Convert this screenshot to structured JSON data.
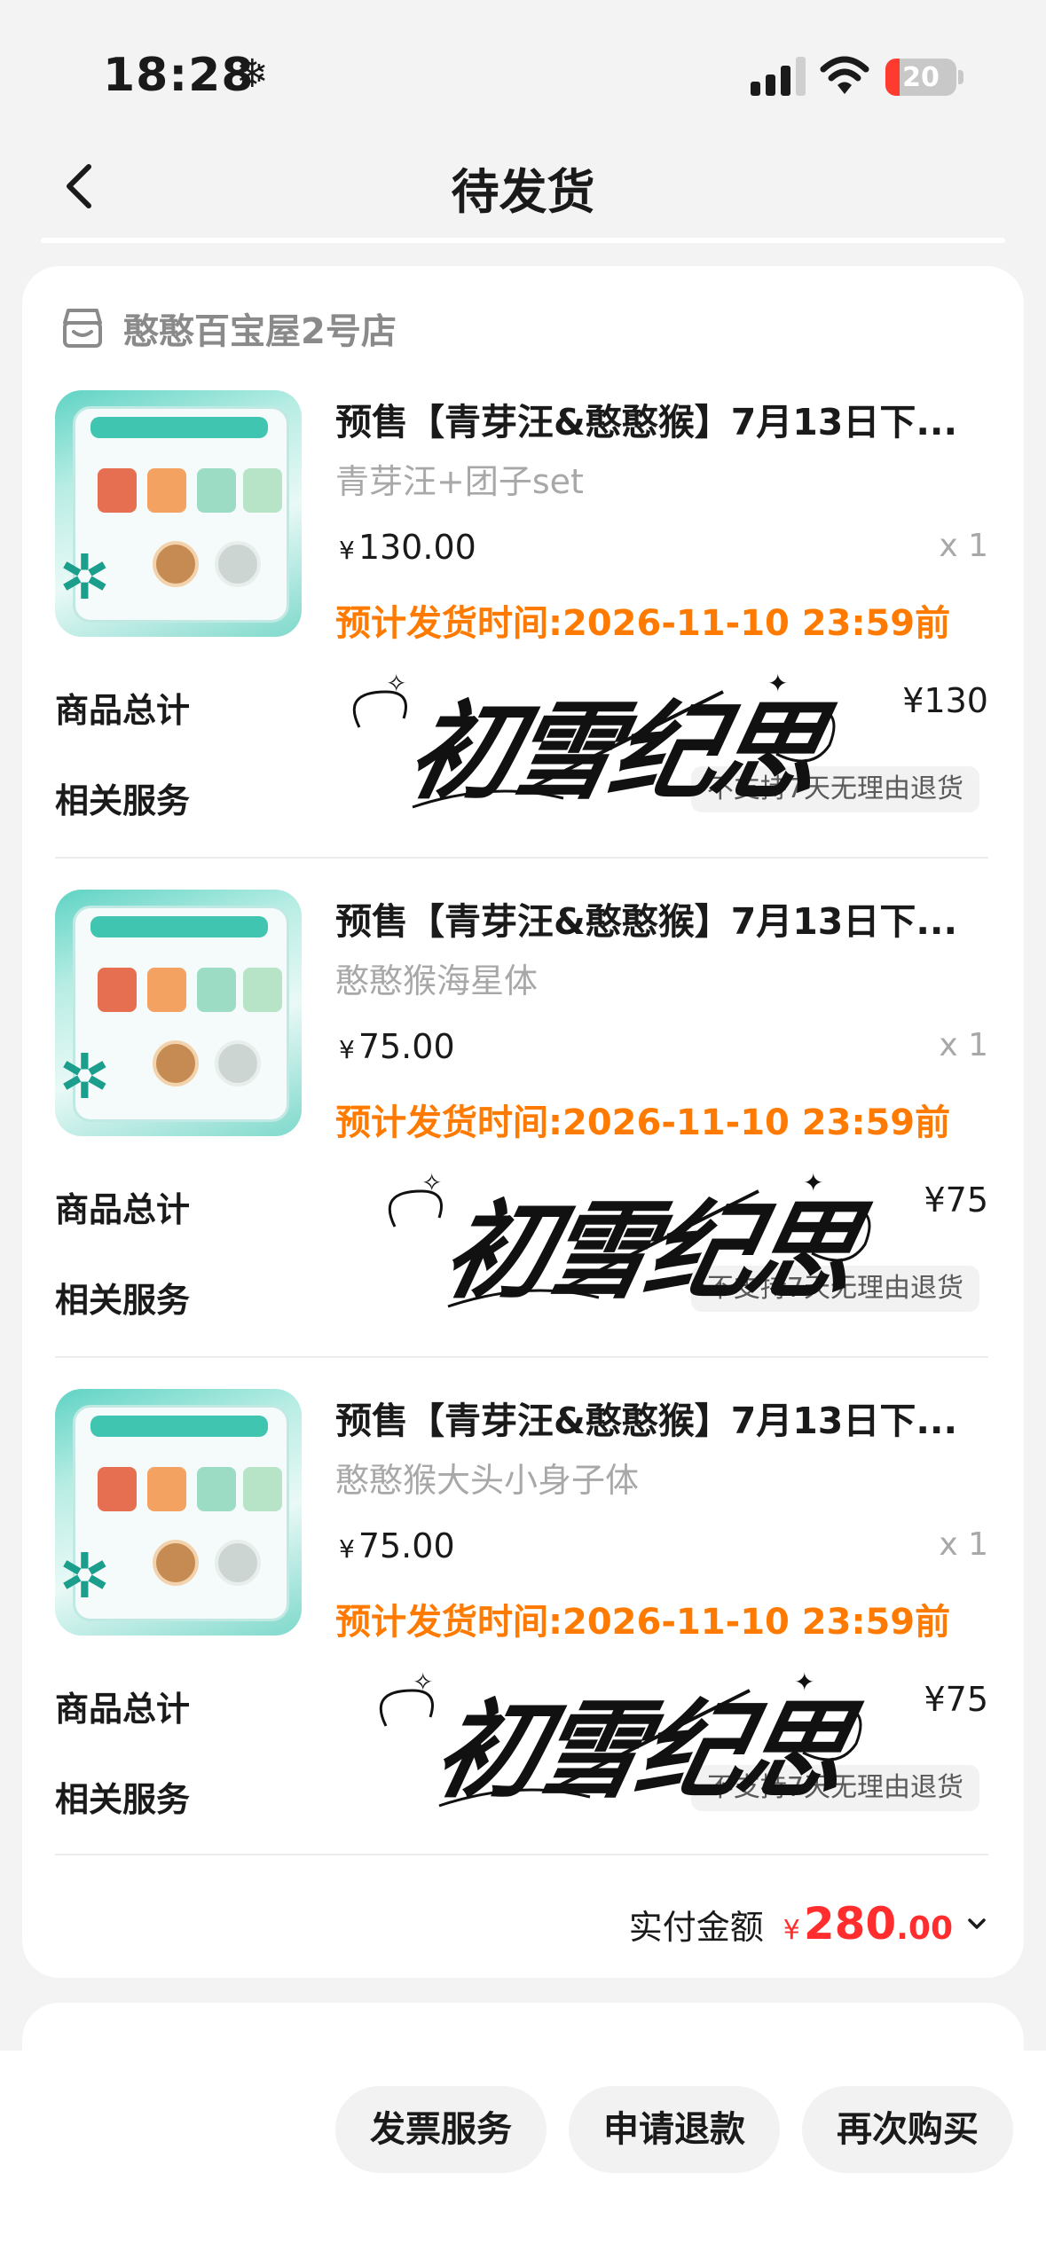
{
  "status_bar": {
    "time": "18:28",
    "weather_glyph": "❄",
    "battery": "20",
    "battery_level": 0.2
  },
  "nav": {
    "title": "待发货"
  },
  "shop": {
    "name": "憨憨百宝屋2号店"
  },
  "items": [
    {
      "title": "预售【青芽汪&憨憨猴】7月13日下...",
      "spec": "青芽汪+团子set",
      "price_symbol": "¥",
      "price": "130.00",
      "qty": "x 1",
      "ship_time": "预计发货时间:2026-11-10 23:59前",
      "total_label": "商品总计",
      "total_value": "¥130",
      "service_label": "相关服务",
      "service_tag": "不支持7天无理由退货",
      "signature": "初雪纪思"
    },
    {
      "title": "预售【青芽汪&憨憨猴】7月13日下...",
      "spec": "憨憨猴海星体",
      "price_symbol": "¥",
      "price": "75.00",
      "qty": "x 1",
      "ship_time": "预计发货时间:2026-11-10 23:59前",
      "total_label": "商品总计",
      "total_value": "¥75",
      "service_label": "相关服务",
      "service_tag": "不支持7天无理由退货",
      "signature": "初雪纪思"
    },
    {
      "title": "预售【青芽汪&憨憨猴】7月13日下...",
      "spec": "憨憨猴大头小身子体",
      "price_symbol": "¥",
      "price": "75.00",
      "qty": "x 1",
      "ship_time": "预计发货时间:2026-11-10 23:59前",
      "total_label": "商品总计",
      "total_value": "¥75",
      "service_label": "相关服务",
      "service_tag": "不支持7天无理由退货",
      "signature": "初雪纪思"
    }
  ],
  "payment": {
    "label": "实付金额",
    "currency": "¥",
    "amount_int": "280",
    "amount_dec": ".00"
  },
  "actions": {
    "invoice": "发票服务",
    "refund": "申请退款",
    "rebuy": "再次购买"
  },
  "colors": {
    "accent_orange": "#ff7a00",
    "price_red": "#ff2d2d"
  }
}
